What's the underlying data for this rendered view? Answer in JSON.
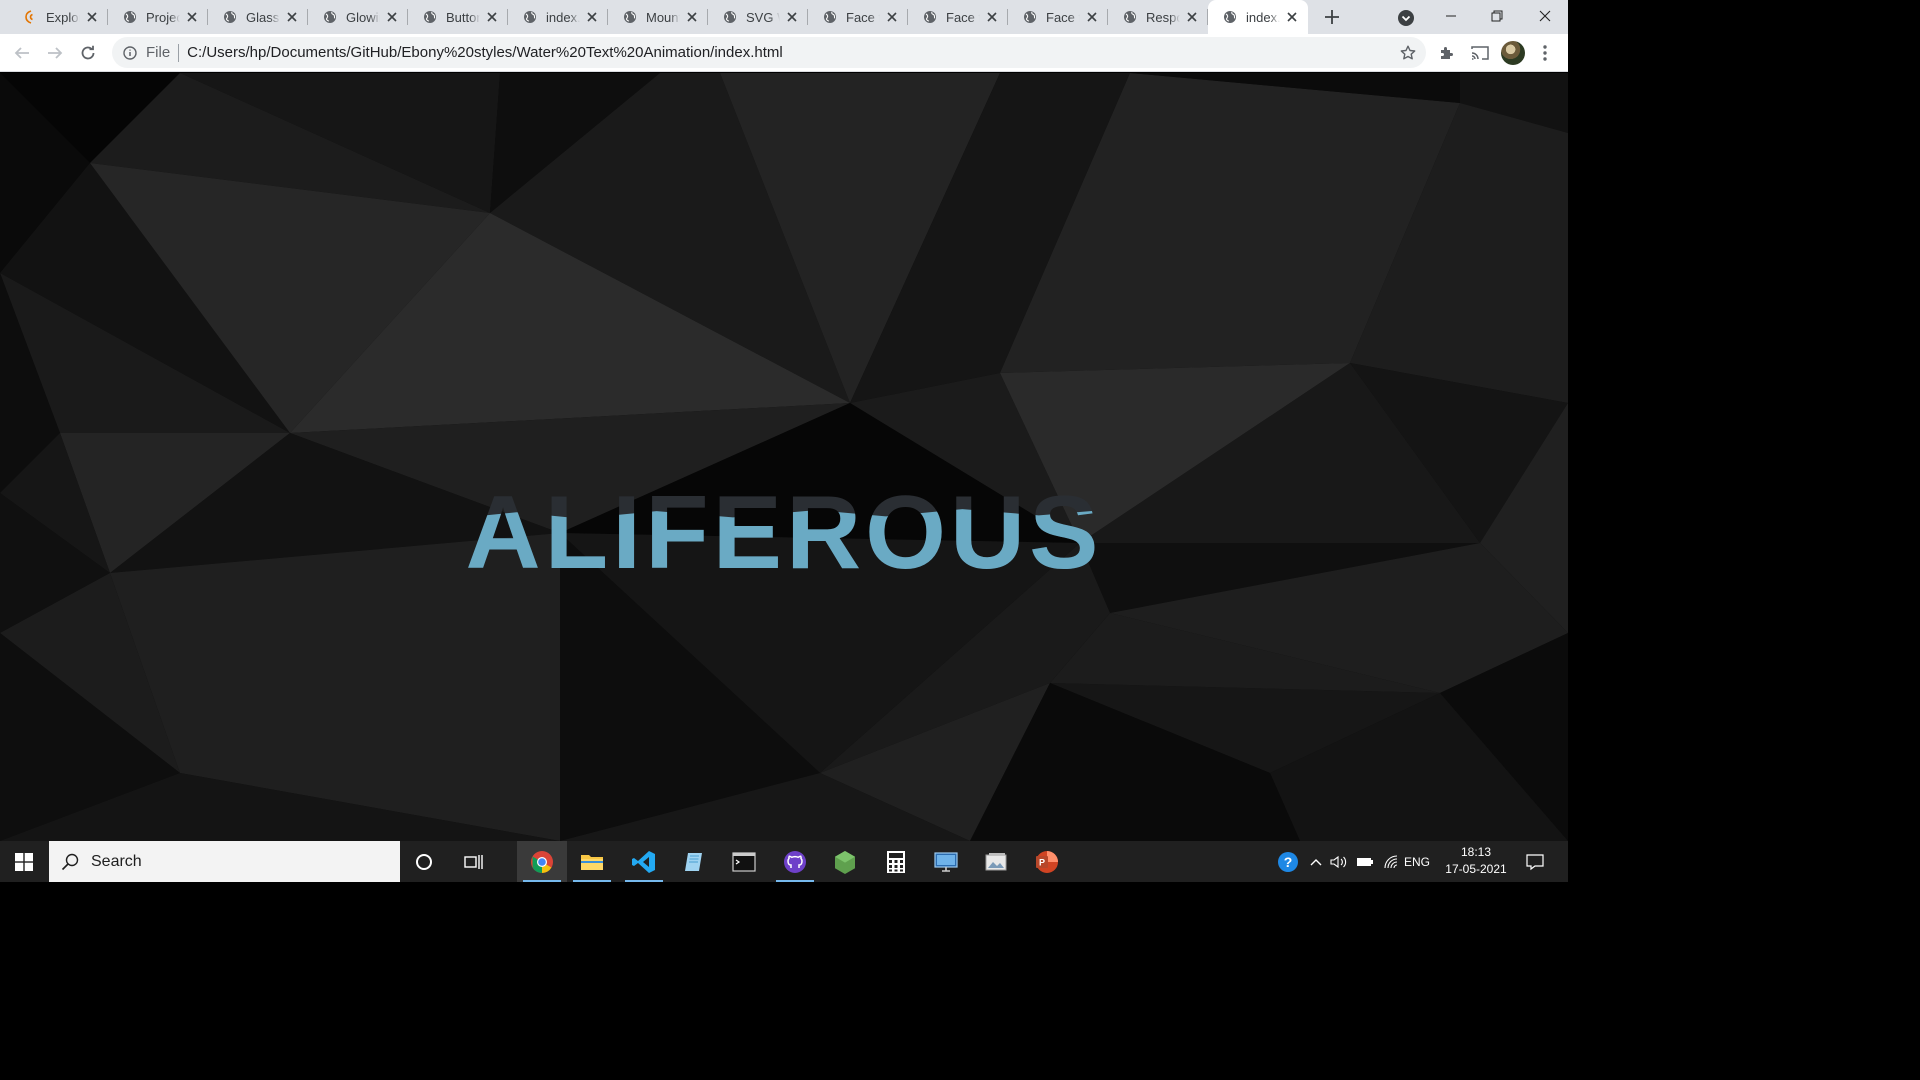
{
  "browser": {
    "tabs": [
      {
        "title": "Explore",
        "favicon": "codepen-icon"
      },
      {
        "title": "Projects",
        "favicon": "globe-icon"
      },
      {
        "title": "Glass UI",
        "favicon": "globe-icon"
      },
      {
        "title": "Glowing",
        "favicon": "globe-icon"
      },
      {
        "title": "Buttons",
        "favicon": "globe-icon"
      },
      {
        "title": "index.html",
        "favicon": "globe-icon"
      },
      {
        "title": "Mountain",
        "favicon": "globe-icon"
      },
      {
        "title": "SVG Wave",
        "favicon": "globe-icon"
      },
      {
        "title": "Face to",
        "favicon": "globe-icon"
      },
      {
        "title": "Face to",
        "favicon": "globe-icon"
      },
      {
        "title": "Face to",
        "favicon": "globe-icon"
      },
      {
        "title": "Responsive",
        "favicon": "globe-icon"
      },
      {
        "title": "index.html",
        "favicon": "globe-icon",
        "active": true
      }
    ],
    "address": {
      "scheme": "File",
      "url": "C:/Users/hp/Documents/GitHub/Ebony%20styles/Water%20Text%20Animation/index.html"
    }
  },
  "page": {
    "hero_text": "ALIFEROUS",
    "water_color": "#6aaac4",
    "background_color": "#0c0c0c"
  },
  "taskbar": {
    "search_placeholder": "Search",
    "apps": [
      "chrome",
      "file-explorer",
      "vscode",
      "notepad",
      "terminal",
      "github-desktop",
      "nodejs",
      "calculator",
      "remote-desktop",
      "photos",
      "powerpoint"
    ],
    "language": "ENG",
    "time": "18:13",
    "date": "17-05-2021"
  }
}
